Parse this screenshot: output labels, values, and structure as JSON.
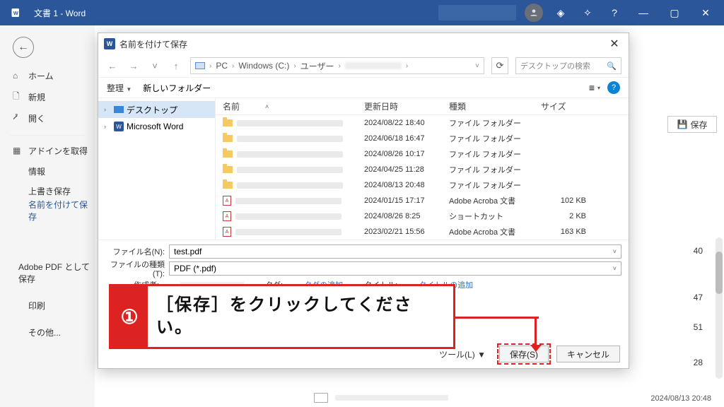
{
  "titlebar": {
    "title": "文書 1  -  Word"
  },
  "backstage": {
    "home": "ホーム",
    "new": "新規",
    "open": "開く",
    "addins": "アドインを取得",
    "info": "情報",
    "save": "上書き保存",
    "saveas": "名前を付けて保存",
    "adobepdf": "Adobe PDF として保存",
    "print": "印刷",
    "other": "その他..."
  },
  "right_panel": {
    "save_button": "保存",
    "side_numbers": [
      "40",
      "47",
      "51",
      "28"
    ],
    "status_time": "2024/08/13 20:48"
  },
  "dialog": {
    "title": "名前を付けて保存",
    "path": {
      "pc": "PC",
      "drive": "Windows (C:)",
      "users": "ユーザー"
    },
    "search_placeholder": "デスクトップの検索",
    "toolbar": {
      "organize": "整理",
      "newfolder": "新しいフォルダー"
    },
    "tree": {
      "desktop": "デスクトップ",
      "word": "Microsoft Word"
    },
    "columns": {
      "name": "名前",
      "date": "更新日時",
      "kind": "種類",
      "size": "サイズ"
    },
    "rows": [
      {
        "icon": "folder",
        "date": "2024/08/22 18:40",
        "kind": "ファイル フォルダー",
        "size": ""
      },
      {
        "icon": "folder",
        "date": "2024/06/18 16:47",
        "kind": "ファイル フォルダー",
        "size": ""
      },
      {
        "icon": "folder",
        "date": "2024/08/26 10:17",
        "kind": "ファイル フォルダー",
        "size": ""
      },
      {
        "icon": "folder",
        "date": "2024/04/25 11:28",
        "kind": "ファイル フォルダー",
        "size": ""
      },
      {
        "icon": "folder",
        "date": "2024/08/13 20:48",
        "kind": "ファイル フォルダー",
        "size": ""
      },
      {
        "icon": "pdf",
        "date": "2024/01/15 17:17",
        "kind": "Adobe Acroba 文書",
        "size": "102 KB"
      },
      {
        "icon": "pdf",
        "date": "2024/08/26 8:25",
        "kind": "ショートカット",
        "size": "2 KB"
      },
      {
        "icon": "pdf",
        "date": "2023/02/21 15:56",
        "kind": "Adobe Acroba 文書",
        "size": "163 KB"
      }
    ],
    "filename_label": "ファイル名(N):",
    "filename_value": "test.pdf",
    "filetype_label": "ファイルの種類(T):",
    "filetype_value": "PDF (*.pdf)",
    "meta": {
      "author_label": "作成者:",
      "tag_label": "タグ:",
      "tag_link": "タグの追加",
      "title_label": "タイトル:",
      "title_link": "タイトルの追加"
    },
    "buttons": {
      "tools": "ツール(L)",
      "save": "保存(S)",
      "cancel": "キャンセル"
    }
  },
  "instruction": {
    "badge": "①",
    "text": "［保存］をクリックしてください。"
  }
}
